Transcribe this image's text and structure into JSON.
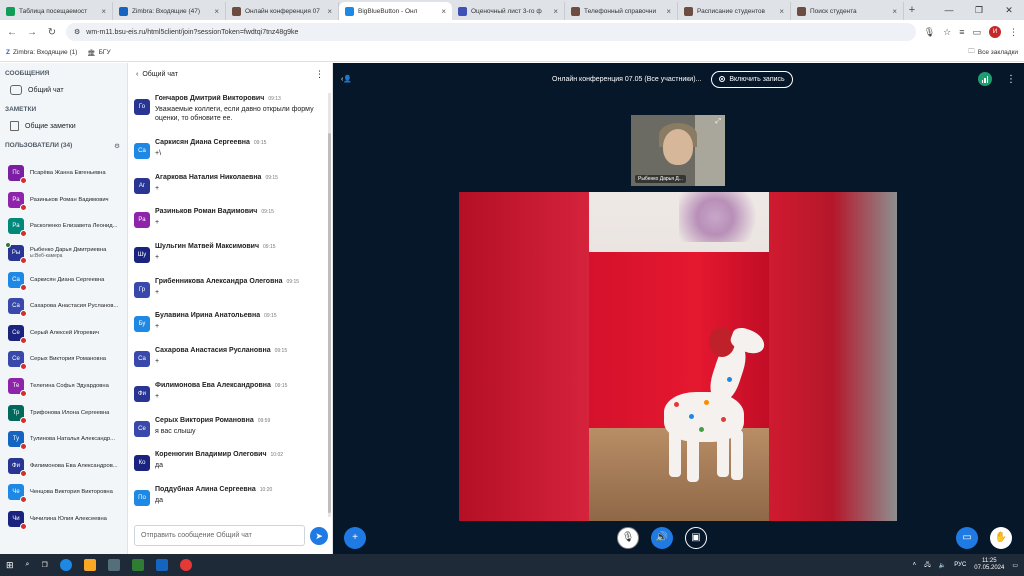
{
  "browser": {
    "tabs": [
      {
        "label": "Таблица посещаемост",
        "color": "#0f9d58"
      },
      {
        "label": "Zimbra: Входящие (47)",
        "color": "#1565c0"
      },
      {
        "label": "Онлайн конференция 07",
        "color": "#6d4c41"
      },
      {
        "label": "BigBlueButton - Онл",
        "color": "#1e88e5",
        "active": true
      },
      {
        "label": "Оценочный лист 3-го ф",
        "color": "#3f51b5"
      },
      {
        "label": "Телефонный справочни",
        "color": "#6d4c41"
      },
      {
        "label": "Расписание студентов",
        "color": "#6d4c41"
      },
      {
        "label": "Поиск студента",
        "color": "#6d4c41"
      }
    ],
    "url": "wm-m11.bsu-eis.ru/html5client/join?sessionToken=fwdtqi7tnz48g9ke",
    "profile_initial": "И",
    "bookmarks": [
      "Zimbra: Входящие (1)",
      "БГУ"
    ],
    "all_bookmarks": "Все закладки"
  },
  "sidebar": {
    "messages_heading": "СООБЩЕНИЯ",
    "public_chat": "Общий чат",
    "notes_heading": "ЗАМЕТКИ",
    "shared_notes": "Общие заметки",
    "users_heading": "ПОЛЬЗОВАТЕЛИ (34)",
    "users": [
      {
        "initials": "Пс",
        "name": "Псарёва Жанна Евгеньевна",
        "color": "#7b1fa2"
      },
      {
        "initials": "Ра",
        "name": "Разиньков Роман Вадимович",
        "color": "#8e24aa"
      },
      {
        "initials": "Ра",
        "name": "Расколенко Елизавета Леонид...",
        "color": "#00897b"
      },
      {
        "initials": "Ры",
        "name": "Рыбенко Дарья Дмитриевна",
        "sub": "ы:Веб-камера",
        "color": "#283593",
        "cam": true
      },
      {
        "initials": "Са",
        "name": "Саркисян Диана Сергеевна",
        "color": "#1e88e5"
      },
      {
        "initials": "Са",
        "name": "Сахарова Анастасия Русланов...",
        "color": "#3949ab"
      },
      {
        "initials": "Се",
        "name": "Серый Алексей Игоревич",
        "color": "#1a237e"
      },
      {
        "initials": "Се",
        "name": "Серых Виктория Романовна",
        "color": "#3949ab"
      },
      {
        "initials": "Те",
        "name": "Телегина Софья Эдуардовна",
        "color": "#8e24aa"
      },
      {
        "initials": "Тр",
        "name": "Трифонова Илона Сергеевна",
        "color": "#00695c"
      },
      {
        "initials": "Ту",
        "name": "Тулинова Наталья Александр...",
        "color": "#1565c0"
      },
      {
        "initials": "Фи",
        "name": "Филимонова Ева Александров...",
        "color": "#283593"
      },
      {
        "initials": "Че",
        "name": "Ченцова Виктория Викторовна",
        "color": "#1e88e5"
      },
      {
        "initials": "Чи",
        "name": "Чичилина Юлия Алексеевна",
        "color": "#1a237e"
      }
    ]
  },
  "chat": {
    "title": "Общий чат",
    "placeholder": "Отправить сообщение Общий чат",
    "messages": [
      {
        "initials": "Го",
        "name": "Гончаров Дмитрий Викторович",
        "time": "09:13",
        "text": "Уважаемые коллеги, если давно открыли форму оценки, то обновите ее.",
        "color": "#283593"
      },
      {
        "initials": "Са",
        "name": "Саркисян Диана Сергеевна",
        "time": "09:15",
        "text": "+\\",
        "color": "#1e88e5"
      },
      {
        "initials": "Аг",
        "name": "Агаркова Наталия Николаевна",
        "time": "09:15",
        "text": "+",
        "color": "#283593"
      },
      {
        "initials": "Ра",
        "name": "Разиньков Роман Вадимович",
        "time": "09:15",
        "text": "+",
        "color": "#8e24aa"
      },
      {
        "initials": "Шу",
        "name": "Шульгин Матвей Максимович",
        "time": "09:15",
        "text": "+",
        "color": "#1a237e"
      },
      {
        "initials": "Гр",
        "name": "Грибенникова Александра Олеговна",
        "time": "09:15",
        "text": "+",
        "color": "#3949ab"
      },
      {
        "initials": "Бу",
        "name": "Булавина Ирина Анатольевна",
        "time": "09:15",
        "text": "+",
        "color": "#1e88e5"
      },
      {
        "initials": "Са",
        "name": "Сахарова Анастасия Руслановна",
        "time": "09:15",
        "text": "+",
        "color": "#3949ab"
      },
      {
        "initials": "Фи",
        "name": "Филимонова Ева Александровна",
        "time": "09:15",
        "text": "+",
        "color": "#283593"
      },
      {
        "initials": "Се",
        "name": "Серых Виктория Романовна",
        "time": "09:59",
        "text": "я вас слышу",
        "color": "#3949ab"
      },
      {
        "initials": "Ко",
        "name": "Коренюгин Владимир Олегович",
        "time": "10:02",
        "text": "да",
        "color": "#1a237e"
      },
      {
        "initials": "По",
        "name": "Поддубная Алина Сергеевна",
        "time": "10:20",
        "text": "да",
        "color": "#1e88e5"
      }
    ]
  },
  "meeting": {
    "title": "Онлайн конференция 07.05 (Все участники)...",
    "record_label": "Включить запись",
    "webcam_label": "Рыбенко Дарья Д..."
  },
  "taskbar": {
    "lang": "РУС",
    "time": "11:25",
    "date": "07.05.2024"
  }
}
